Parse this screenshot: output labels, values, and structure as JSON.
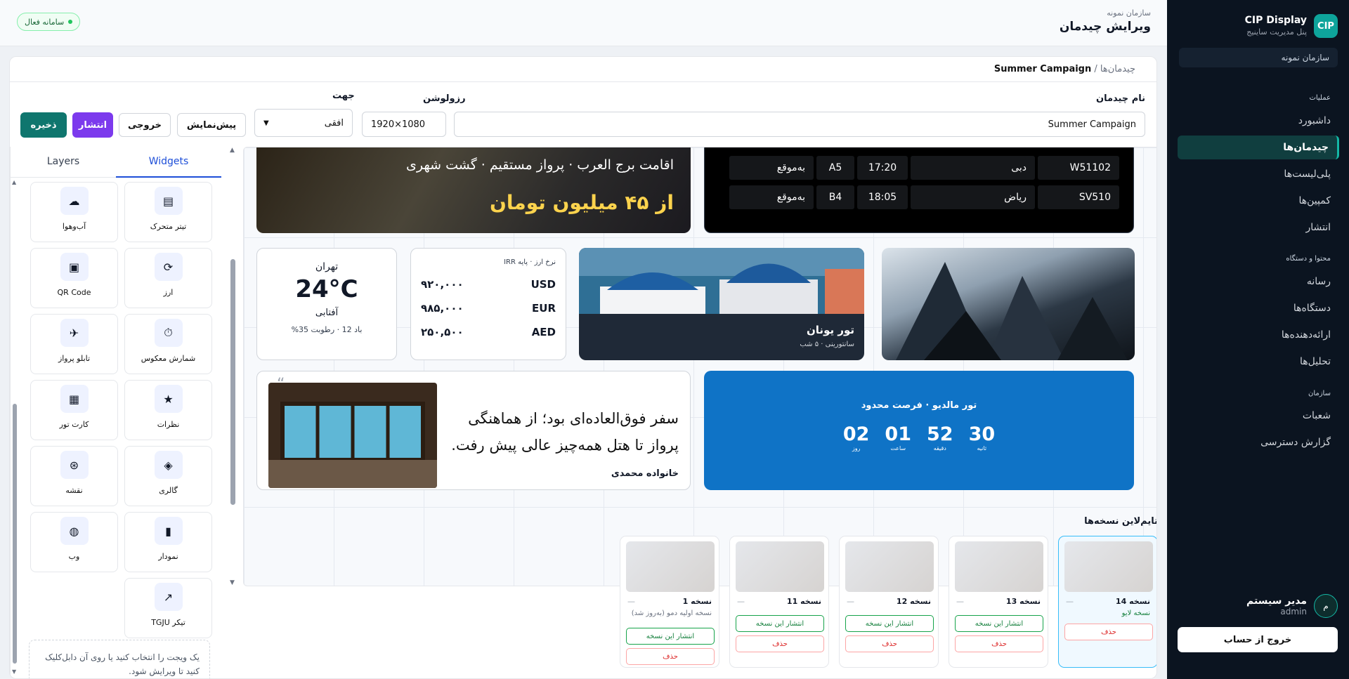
{
  "sidebar": {
    "logo": "CIP",
    "app_title": "CIP Display",
    "app_subtitle": "پنل مدیریت ساینیج",
    "org": "سازمان نمونه",
    "group_ops": "عملیات",
    "group_content": "محتوا و دستگاه",
    "group_org": "سازمان",
    "items": [
      {
        "label": "داشبورد"
      },
      {
        "label": "چیدمان‌ها"
      },
      {
        "label": "پلی‌لیست‌ها"
      },
      {
        "label": "کمپین‌ها"
      },
      {
        "label": "انتشار"
      },
      {
        "label": "رسانه"
      },
      {
        "label": "دستگاه‌ها"
      },
      {
        "label": "ارائه‌دهنده‌ها"
      },
      {
        "label": "تحلیل‌ها"
      },
      {
        "label": "شعبات"
      },
      {
        "label": "گزارش دسترسی"
      }
    ],
    "user_initial": "م",
    "user_name": "مدیر سیستم",
    "user_role": "admin",
    "logout": "خروج از حساب"
  },
  "header": {
    "org": "سازمان نمونه",
    "title": "ویرایش چیدمان",
    "status": "سامانه فعال"
  },
  "editor": {
    "breadcrumb_root": "چیدمان‌ها",
    "breadcrumb_sep": "/",
    "breadcrumb_current": "Summer Campaign",
    "name_label": "نام چیدمان",
    "name_value": "Summer Campaign",
    "resolution_label": "رزولوشن",
    "resolution_value": "1920×1080",
    "orientation_label": "جهت",
    "orientation_value": "افقی",
    "btn_preview": "پیش‌نمایش",
    "btn_export": "خروجی",
    "btn_publish": "انتشار",
    "btn_save": "ذخیره"
  },
  "canvas": {
    "promo": {
      "line1": "اقامت برج العرب · پرواز مستقیم · گشت شهری",
      "line2": "از ۴۵ میلیون تومان"
    },
    "flights": [
      {
        "code": "W51102",
        "city": "دبی",
        "time": "17:20",
        "gate": "A5",
        "status": "به‌موقع"
      },
      {
        "code": "SV510",
        "city": "ریاض",
        "time": "18:05",
        "gate": "B4",
        "status": "به‌موقع"
      }
    ],
    "weather": {
      "city": "تهران",
      "temp": "24°C",
      "cond": "آفتابی",
      "detail": "باد 12 · رطوبت 35%"
    },
    "currency": {
      "caption": "نرخ ارز · پایه IRR",
      "rows": [
        {
          "code": "USD",
          "value": "۹۲۰,۰۰۰"
        },
        {
          "code": "EUR",
          "value": "۹۸۵,۰۰۰"
        },
        {
          "code": "AED",
          "value": "۲۵۰,۵۰۰"
        }
      ]
    },
    "tour": {
      "title": "تور یونان",
      "sub": "سانتورینی · ۵ شب"
    },
    "testimonial": {
      "quote_mark": "“",
      "text": "سفر فوق‌العاده‌ای بود؛ از هماهنگی پرواز تا هتل همه‌چیز عالی پیش رفت.",
      "author": "خانواده محمدی"
    },
    "countdown": {
      "title": "تور مالدیو · فرصت محدود",
      "units": [
        {
          "value": "30",
          "label": "ثانیه"
        },
        {
          "value": "52",
          "label": "دقیقه"
        },
        {
          "value": "01",
          "label": "ساعت"
        },
        {
          "value": "02",
          "label": "روز"
        }
      ]
    }
  },
  "widgets": {
    "tab_widgets": "Widgets",
    "tab_layers": "Layers",
    "items": [
      {
        "label": "تیتر متحرک",
        "icon": "ticker-icon",
        "glyph": "▤"
      },
      {
        "label": "آب‌وهوا",
        "icon": "weather-icon",
        "glyph": "☁"
      },
      {
        "label": "ارز",
        "icon": "currency-icon",
        "glyph": "⟳"
      },
      {
        "label": "QR Code",
        "icon": "qr-icon",
        "glyph": "▣"
      },
      {
        "label": "شمارش معکوس",
        "icon": "timer-icon",
        "glyph": "⏱"
      },
      {
        "label": "تابلو پرواز",
        "icon": "plane-icon",
        "glyph": "✈"
      },
      {
        "label": "نظرات",
        "icon": "star-icon",
        "glyph": "★"
      },
      {
        "label": "کارت تور",
        "icon": "bus-icon",
        "glyph": "▦"
      },
      {
        "label": "گالری",
        "icon": "gallery-icon",
        "glyph": "◈"
      },
      {
        "label": "نقشه",
        "icon": "map-icon",
        "glyph": "⊛"
      },
      {
        "label": "نمودار",
        "icon": "chart-icon",
        "glyph": "▮"
      },
      {
        "label": "وب",
        "icon": "globe-icon",
        "glyph": "◍"
      },
      {
        "label": "تیکر TGJU",
        "icon": "line-chart-icon",
        "glyph": "↗"
      }
    ],
    "hint": "یک ویجت را انتخاب کنید یا روی آن دابل‌کلیک کنید تا ویرایش شود."
  },
  "timeline": {
    "title": "تایم‌لاین نسخه‌ها",
    "dash": "—",
    "publish_label": "انتشار این نسخه",
    "delete_label": "حذف",
    "versions": [
      {
        "name": "نسخه 14",
        "note": "نسخه لایو"
      },
      {
        "name": "نسخه 13",
        "note": ""
      },
      {
        "name": "نسخه 12",
        "note": ""
      },
      {
        "name": "نسخه 11",
        "note": ""
      },
      {
        "name": "نسخه 1",
        "note": "نسخه اولیه دمو (به‌روز شد)"
      }
    ]
  },
  "colors": {
    "accent": "#14b8a6",
    "publish": "#7c3aed",
    "save": "#0f766e",
    "countdown": "#0f73c6"
  }
}
